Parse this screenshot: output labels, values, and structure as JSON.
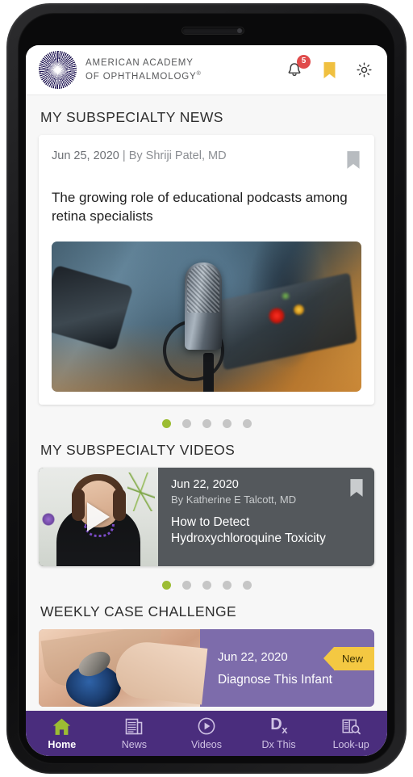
{
  "header": {
    "logo_icon": "aao-starburst-logo",
    "brand_line1": "AMERICAN ACADEMY",
    "brand_line2": "OF OPHTHALMOLOGY",
    "brand_registered": "®",
    "notification_icon": "bell-icon",
    "notification_count": "5",
    "bookmark_icon": "bookmark-icon",
    "settings_icon": "gear-icon",
    "accent_yellow": "#f0c040",
    "badge_red": "#e04b4b"
  },
  "sections": {
    "news": {
      "title": "MY SUBSPECIALTY NEWS",
      "card": {
        "date": "Jun 25, 2020",
        "separator": "|",
        "author": "By Shriji Patel, MD",
        "title": "The growing role of educational podcasts among retina specialists",
        "bookmark_icon": "bookmark-outline-icon",
        "image_alt": "studio-microphone-photo"
      },
      "pagination": {
        "total": 5,
        "active": 1,
        "active_color": "#9cbd33",
        "inactive_color": "#c6c6c6"
      }
    },
    "videos": {
      "title": "MY SUBSPECIALTY VIDEOS",
      "card": {
        "date": "Jun 22, 2020",
        "author": "By Katherine E Talcott, MD",
        "title": "How to Detect Hydroxychloroquine Toxicity",
        "bookmark_icon": "bookmark-icon",
        "play_icon": "play-triangle-icon",
        "thumbnail_alt": "speaker-video-thumbnail",
        "bg_color": "#54585c"
      },
      "pagination": {
        "total": 5,
        "active": 1,
        "active_color": "#9cbd33",
        "inactive_color": "#c6c6c6"
      }
    },
    "case": {
      "title": "WEEKLY CASE CHALLENGE",
      "card": {
        "date": "Jun 22, 2020",
        "title": "Diagnose This Infant",
        "badge": "New",
        "badge_color": "#f4c842",
        "bg_color": "#7d6cab",
        "thumbnail_alt": "clinical-eye-photo"
      }
    }
  },
  "bottom_nav": {
    "background": "#4a2d7d",
    "active_icon_color": "#9cbd33",
    "items": [
      {
        "label": "Home",
        "icon": "home-icon",
        "active": true
      },
      {
        "label": "News",
        "icon": "newspaper-icon",
        "active": false
      },
      {
        "label": "Videos",
        "icon": "play-circle-icon",
        "active": false
      },
      {
        "label": "Dx This",
        "icon": "dx-icon",
        "active": false
      },
      {
        "label": "Look-up",
        "icon": "book-search-icon",
        "active": false
      }
    ]
  }
}
